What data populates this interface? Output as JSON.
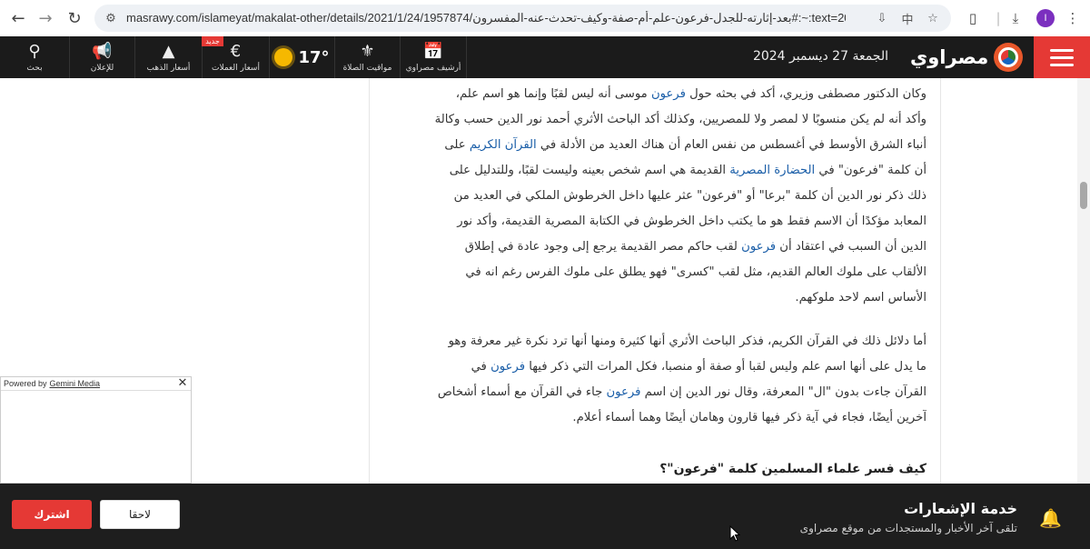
{
  "browser": {
    "url": "masrawy.com/islameyat/makalat-other/details/2021/1/24/1957874/كيف-فسر-علماء-المسلمين-كلمة-فرعون-وماذا-تعني-في-القرآن-الكريم",
    "url_display": "masrawy.com/islameyat/makalat-other/details/2021/1/24/1957874/بعد-إثارته-للجدل-فرعون-علم-أم-صفة-وكيف-تحدث-عنه-المفسرون#:~:text=كيف%20...",
    "profile_initial": "I",
    "icons": [
      "back-icon",
      "forward-icon",
      "reload-icon",
      "site-info-icon",
      "install-icon",
      "translate-icon",
      "bookmark-star-icon",
      "extensions-icon",
      "downloads-icon",
      "profile-avatar",
      "menu-kebab-icon"
    ]
  },
  "header": {
    "logo_text": "مصراوي",
    "date": "الجمعة 27 ديسمبر 2024",
    "items": [
      {
        "label": "أرشيف مصراوي",
        "icon": "calendar-icon"
      },
      {
        "label": "مواقيت الصلاة",
        "icon": "mosque-icon"
      },
      {
        "label": "أسعار العملات",
        "icon": "currency-icon",
        "badge": "جديد"
      },
      {
        "label": "أسعار الذهب",
        "icon": "gold-icon"
      },
      {
        "label": "للإعلان",
        "icon": "megaphone-icon"
      },
      {
        "label": "بحث",
        "icon": "search-icon"
      }
    ],
    "temperature": "17°",
    "brand_color": "#e53935"
  },
  "article": {
    "para1": [
      {
        "parts": [
          "وكان الدكتور مصطفى وزيري، أكد في بحثه حول ",
          {
            "link": "فرعون"
          },
          " موسى أنه ليس لقبًا وإنما هو اسم علم،"
        ]
      },
      {
        "parts": [
          "وأكد أنه لم يكن منسوبًا لا لمصر ولا للمصريين، وكذلك أكد الباحث الأثري أحمد نور الدين حسب وكالة"
        ]
      },
      {
        "parts": [
          "أنباء الشرق الأوسط في أغسطس من نفس العام أن هناك العديد من الأدلة في ",
          {
            "link": "القرآن الكريم"
          },
          " على"
        ]
      },
      {
        "parts": [
          "أن كلمة \"فرعون\" في ",
          {
            "link": "الحضارة المصرية"
          },
          " القديمة هي اسم شخص بعينه وليست لقبًا، وللتدليل على"
        ]
      },
      {
        "parts": [
          "ذلك ذكر نور الدين أن كلمة \"برعا\" أو \"فرعون\" عثر عليها داخل الخرطوش الملكي في العديد من"
        ]
      },
      {
        "parts": [
          "المعابد مؤكدًا أن الاسم فقط هو ما يكتب داخل الخرطوش في الكتابة المصرية القديمة، وأكد نور"
        ]
      },
      {
        "parts": [
          "الدين أن السبب في اعتقاد أن ",
          {
            "link": "فرعون"
          },
          " لقب حاكم مصر القديمة يرجع إلى وجود عادة في إطلاق"
        ]
      },
      {
        "parts": [
          "الألقاب على ملوك العالم القديم، مثل لقب \"كسرى\" فهو يطلق على ملوك الفرس رغم انه في"
        ]
      },
      {
        "parts": [
          "الأساس اسم لاحد ملوكهم."
        ]
      }
    ],
    "para2": [
      {
        "parts": [
          "أما دلائل ذلك في القرآن الكريم، فذكر الباحث الأثري أنها كثيرة ومنها أنها ترد نكرة غير معرفة وهو"
        ]
      },
      {
        "parts": [
          "ما يدل على أنها اسم علم وليس لقبا أو صفة أو منصبا، فكل المرات التي ذكر فيها ",
          {
            "link": "فرعون"
          },
          " في"
        ]
      },
      {
        "parts": [
          "القرآن جاءت بدون \"ال\" المعرفة، وقال نور الدين إن اسم ",
          {
            "link": "فرعون"
          },
          " جاء في القرآن مع أسماء أشخاص"
        ]
      },
      {
        "parts": [
          "آخرين أيضًا، فجاء في آية ذكر فيها قارون وهامان أيضًا وهما أسماء أعلام."
        ]
      }
    ],
    "subheading": "كيف فسر علماء المسلمين كلمة \"فرعون\"؟"
  },
  "gemini": {
    "powered_by": "Powered by",
    "brand": "Gemini Media"
  },
  "notification": {
    "title": "خدمة الإشعارات",
    "subtitle": "تلقى آخر الأخبار والمستجدات من موقع مصراوى",
    "later_label": "لاحقا",
    "subscribe_label": "اشترك"
  }
}
